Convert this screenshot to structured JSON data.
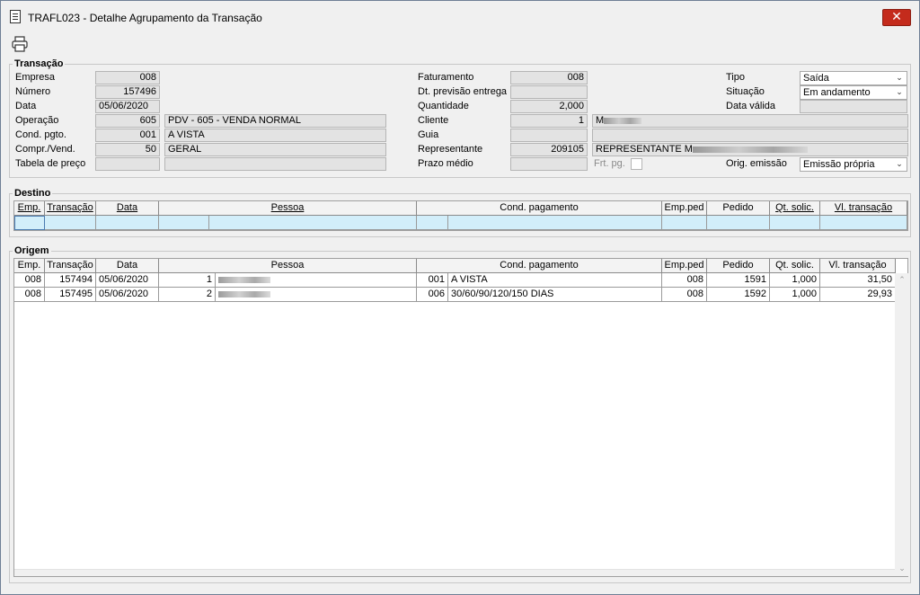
{
  "window": {
    "title": "TRAFL023 - Detalhe Agrupamento da Transação",
    "close_label": "✕"
  },
  "toolbar": {
    "print_icon": "printer-icon"
  },
  "transacao": {
    "title": "Transação",
    "empresa": {
      "label": "Empresa",
      "value": "008"
    },
    "numero": {
      "label": "Número",
      "value": "157496"
    },
    "data": {
      "label": "Data",
      "value": "05/06/2020"
    },
    "operacao": {
      "label": "Operação",
      "code": "605",
      "desc": "PDV - 605 - VENDA NORMAL"
    },
    "cond_pgto": {
      "label": "Cond. pgto.",
      "code": "001",
      "desc": "A VISTA"
    },
    "compr_vend": {
      "label": "Compr./Vend.",
      "code": "50",
      "desc": "GERAL"
    },
    "tabela_preco": {
      "label": "Tabela de preço",
      "code": "",
      "desc": ""
    },
    "faturamento": {
      "label": "Faturamento",
      "value": "008"
    },
    "dt_previsao": {
      "label": "Dt. previsão entrega",
      "value": ""
    },
    "quantidade": {
      "label": "Quantidade",
      "value": "2,000"
    },
    "cliente": {
      "label": "Cliente",
      "code": "1",
      "desc": "M"
    },
    "guia": {
      "label": "Guia",
      "code": "",
      "desc": ""
    },
    "representante": {
      "label": "Representante",
      "code": "209105",
      "desc": "REPRESENTANTE M"
    },
    "prazo_medio": {
      "label": "Prazo médio",
      "value": ""
    },
    "frt_pg": {
      "label": "Frt. pg."
    },
    "tipo": {
      "label": "Tipo",
      "value": "Saída"
    },
    "situacao": {
      "label": "Situação",
      "value": "Em andamento"
    },
    "data_valida": {
      "label": "Data válida",
      "value": ""
    },
    "orig_emissao": {
      "label": "Orig. emissão",
      "value": "Emissão própria"
    }
  },
  "destino": {
    "title": "Destino",
    "headers": [
      "Emp.",
      "Transação",
      "Data",
      "Pessoa",
      "Cond. pagamento",
      "Emp.ped",
      "Pedido",
      "Qt. solic.",
      "Vl. transação"
    ]
  },
  "origem": {
    "title": "Origem",
    "headers": [
      "Emp.",
      "Transação",
      "Data",
      "Pessoa",
      "Cond. pagamento",
      "Emp.ped",
      "Pedido",
      "Qt. solic.",
      "Vl. transação"
    ],
    "rows": [
      {
        "emp": "008",
        "transacao": "157494",
        "data": "05/06/2020",
        "pessoa_code": "1",
        "pessoa_name": "",
        "cond_code": "001",
        "cond_desc": "A VISTA",
        "emp_ped": "008",
        "pedido": "1591",
        "qt_solic": "1,000",
        "vl_transacao": "31,50"
      },
      {
        "emp": "008",
        "transacao": "157495",
        "data": "05/06/2020",
        "pessoa_code": "2",
        "pessoa_name": "",
        "cond_code": "006",
        "cond_desc": "30/60/90/120/150 DIAS",
        "emp_ped": "008",
        "pedido": "1592",
        "qt_solic": "1,000",
        "vl_transacao": "29,93"
      }
    ]
  },
  "colors": {
    "destino_row_bg": "#d2eefa",
    "close_button": "#c42b1c"
  }
}
